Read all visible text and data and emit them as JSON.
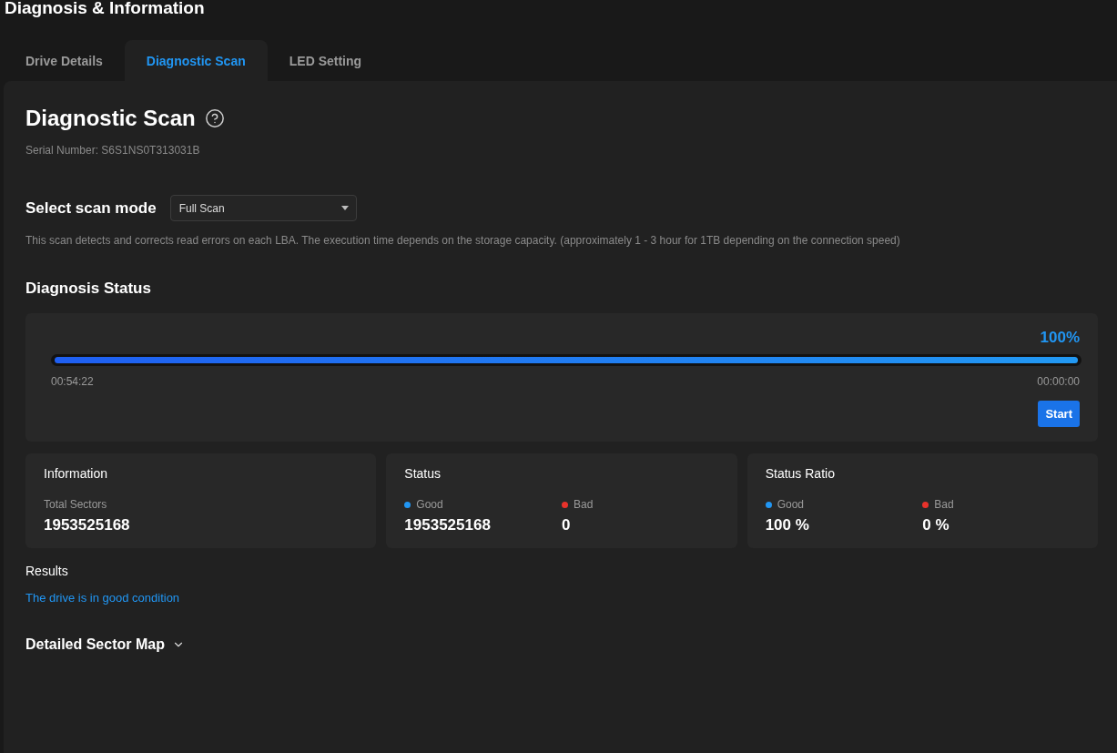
{
  "page": {
    "title": "Diagnosis & Information"
  },
  "tabs": [
    {
      "label": "Drive Details",
      "selected": false
    },
    {
      "label": "Diagnostic Scan",
      "selected": true
    },
    {
      "label": "LED Setting",
      "selected": false
    }
  ],
  "scan": {
    "title": "Diagnostic Scan",
    "serial": "Serial Number: S6S1NS0T313031B"
  },
  "scan_mode": {
    "label": "Select scan mode",
    "value": "Full Scan",
    "description": "This scan detects and corrects read errors on each LBA. The execution time depends on the storage capacity. (approximately 1 - 3 hour for 1TB depending on the connection speed)"
  },
  "diagnosis_status": {
    "title": "Diagnosis Status",
    "percent": "100%",
    "level": 1,
    "elapsed": "00:54:22",
    "remaining": "00:00:00",
    "button": "Start"
  },
  "cards": [
    {
      "title": "Information",
      "stats": [
        {
          "label": "Total Sectors",
          "value": "1953525168"
        }
      ]
    },
    {
      "title": "Status",
      "stats": [
        {
          "label": "Good",
          "value": "1953525168",
          "color": "#2196f3"
        },
        {
          "label": "Bad",
          "value": "0",
          "color": "#e8322b"
        }
      ]
    },
    {
      "title": "Status Ratio",
      "stats": [
        {
          "label": "Good",
          "value": "100 %",
          "color": "#2196f3"
        },
        {
          "label": "Bad",
          "value": "0 %",
          "color": "#e8322b"
        }
      ]
    }
  ],
  "results": {
    "label": "Results",
    "message": "The drive is in good condition"
  },
  "sector_map": {
    "label": "Detailed Sector Map",
    "expanded": false
  }
}
